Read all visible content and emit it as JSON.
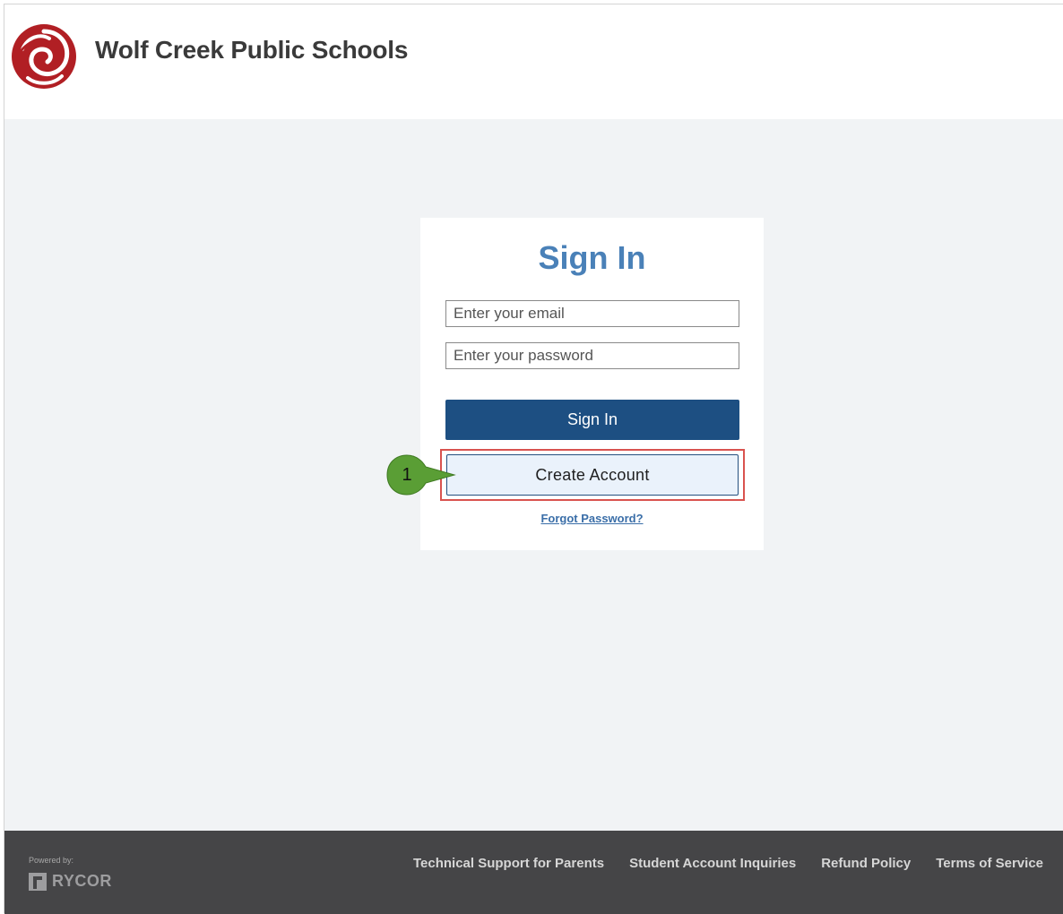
{
  "header": {
    "org_name": "Wolf Creek Public Schools",
    "logo_icon": "swirl-logo-icon",
    "logo_color": "#b11f24"
  },
  "signin_card": {
    "title": "Sign In",
    "email_placeholder": "Enter your email",
    "password_placeholder": "Enter your password",
    "signin_label": "Sign In",
    "create_account_label": "Create Account",
    "forgot_password_label": "Forgot Password?"
  },
  "annotation": {
    "step_number": "1",
    "callout_color": "#5a9e35",
    "highlight_color": "#d9534f"
  },
  "footer": {
    "powered_by_label": "Powered by:",
    "brand_name": "RYCOR",
    "links": [
      "Technical Support for Parents",
      "Student Account Inquiries",
      "Refund Policy",
      "Terms of Service"
    ]
  },
  "colors": {
    "primary_button": "#1d4f82",
    "title_blue": "#4a81b8",
    "footer_bg": "#454547",
    "page_bg": "#f1f3f5"
  }
}
